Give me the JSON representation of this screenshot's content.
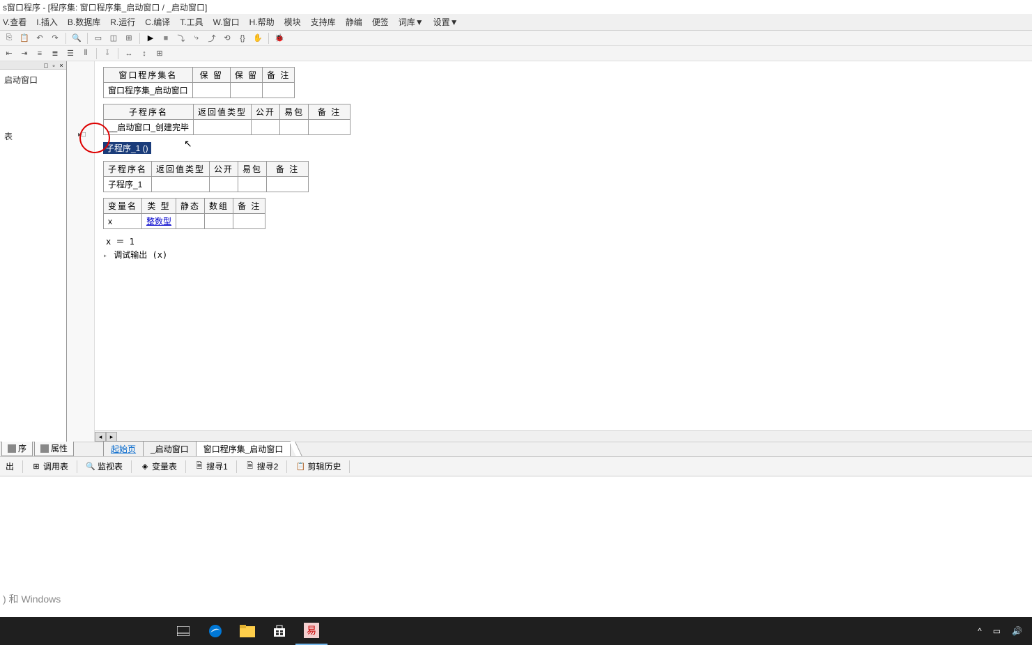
{
  "title": "s窗口程序 - [程序集: 窗口程序集_启动窗口 / _启动窗口]",
  "menu": {
    "view": "V.查看",
    "insert": "I.插入",
    "db": "B.数据库",
    "run": "R.运行",
    "compile": "C.编译",
    "tools": "T.工具",
    "window": "W.窗口",
    "help": "H.帮助",
    "module": "模块",
    "support": "支持库",
    "jingbian": "静编",
    "bianqian": "便签",
    "cilib": "词库▼",
    "settings": "设置▼"
  },
  "sidebar": {
    "close_controls": [
      "□",
      "▫",
      "×"
    ],
    "items": [
      "启动窗口",
      "表"
    ]
  },
  "assembly_table": {
    "headers": [
      "窗口程序集名",
      "保 留",
      "保 留",
      "备 注"
    ],
    "name": "窗口程序集_启动窗口"
  },
  "sub1_table": {
    "headers": [
      "子程序名",
      "返回值类型",
      "公开",
      "易包",
      "备 注"
    ],
    "name": "__启动窗口_创建完毕"
  },
  "highlight_line": "子程序_1 ()",
  "sub2_table": {
    "headers": [
      "子程序名",
      "返回值类型",
      "公开",
      "易包",
      "备 注"
    ],
    "name": "子程序_1"
  },
  "var_table": {
    "headers": [
      "变量名",
      "类 型",
      "静态",
      "数组",
      "备 注"
    ],
    "name": "x",
    "type": "整数型"
  },
  "code": {
    "line1": "x ＝ 1",
    "line2_fn": "调试输出",
    "line2_arg": "(x)"
  },
  "sidebar_tabs": {
    "xu": "序",
    "attr": "属性"
  },
  "doc_tabs": {
    "start": "起始页",
    "win": "_启动窗口",
    "asm": "窗口程序集_启动窗口"
  },
  "bottom_tabs": {
    "out": "出",
    "calltable": "调用表",
    "watch": "监视表",
    "vars": "变量表",
    "search1": "搜寻1",
    "search2": "搜寻2",
    "clipboard": "剪辑历史"
  },
  "watermark": ") 和 Windows",
  "icons": {
    "search": "○",
    "up": "^",
    "tray_net": "▭",
    "tray_vol": "🔊"
  }
}
